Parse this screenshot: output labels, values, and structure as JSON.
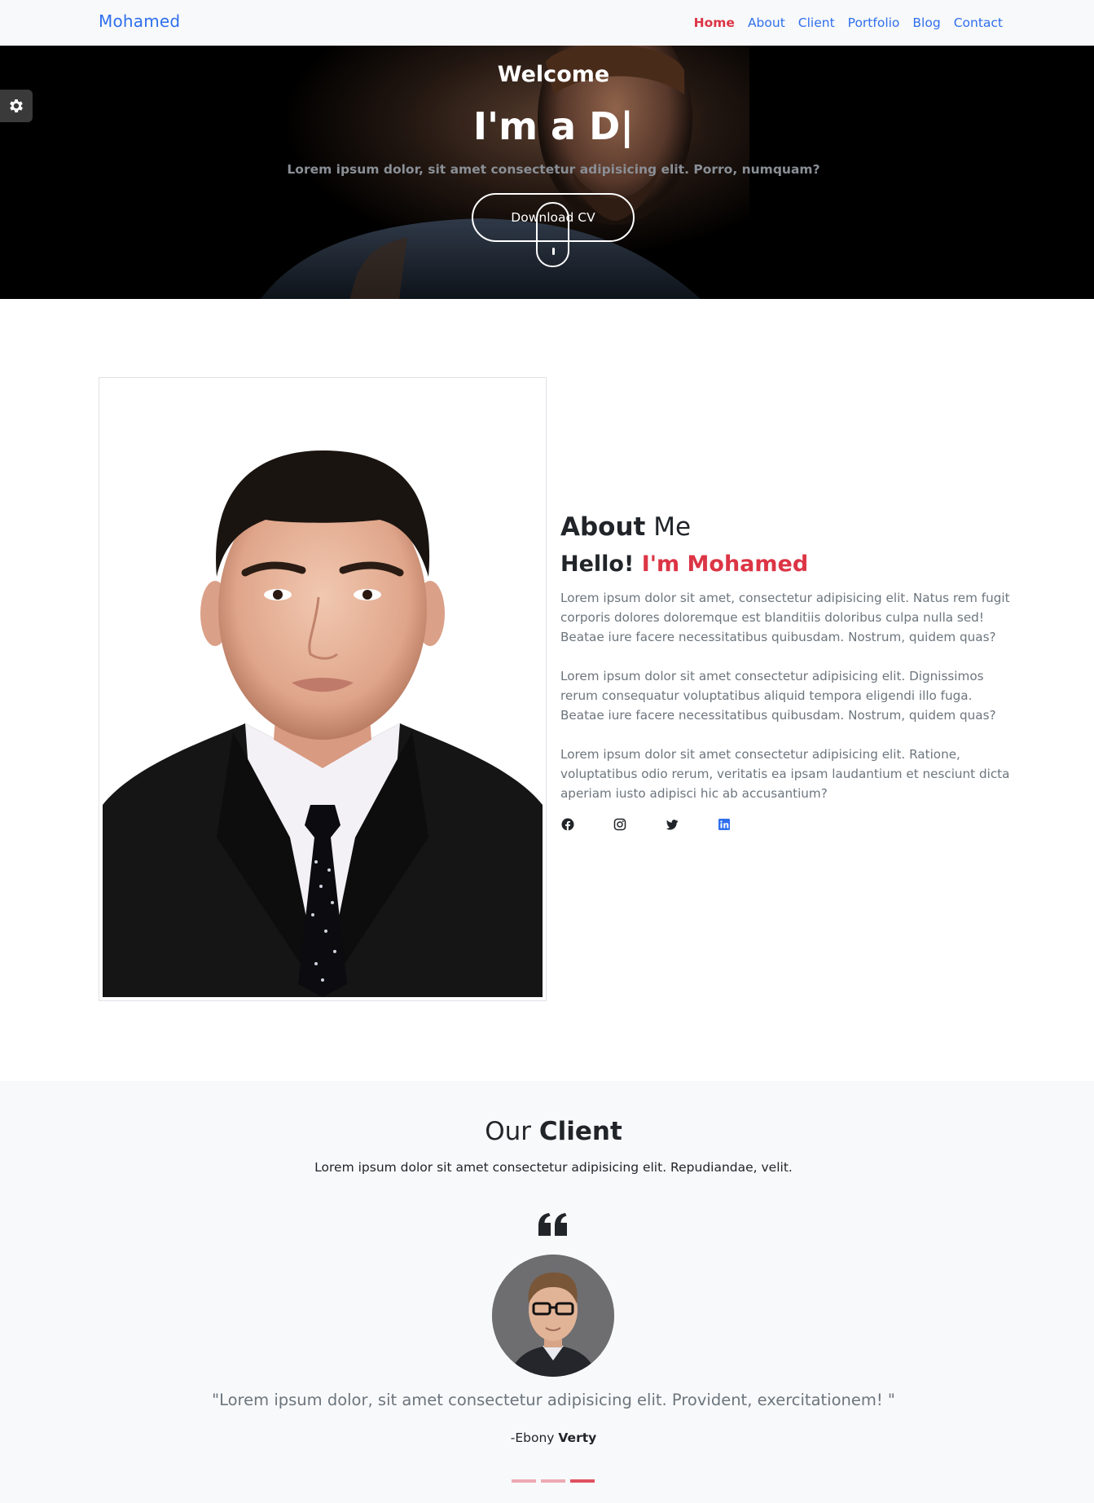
{
  "nav": {
    "brand": "Mohamed",
    "links": [
      {
        "label": "Home",
        "active": true
      },
      {
        "label": "About"
      },
      {
        "label": "Client"
      },
      {
        "label": "Portfolio"
      },
      {
        "label": "Blog"
      },
      {
        "label": "Contact"
      }
    ]
  },
  "hero": {
    "welcome": "Welcome",
    "title": "I'm a D|",
    "subtitle": "Lorem ipsum dolor, sit amet consectetur adipisicing elit. Porro, numquam?",
    "button": "Download CV"
  },
  "settings": {
    "icon": "gear-icon"
  },
  "about": {
    "heading_bold": "About",
    "heading_rest": " Me",
    "hello": "Hello! ",
    "hello_name": "I'm Mohamed",
    "paragraphs": [
      "Lorem ipsum dolor sit amet, consectetur adipisicing elit. Natus rem fugit corporis dolores doloremque est blanditiis doloribus culpa nulla sed! Beatae iure facere necessitatibus quibusdam. Nostrum, quidem quas?",
      "Lorem ipsum dolor sit amet consectetur adipisicing elit. Dignissimos rerum consequatur voluptatibus aliquid tempora eligendi illo fuga. Beatae iure facere necessitatibus quibusdam. Nostrum, quidem quas?",
      "Lorem ipsum dolor sit amet consectetur adipisicing elit. Ratione, voluptatibus odio rerum, veritatis ea ipsam laudantium et nesciunt dicta aperiam iusto adipisci hic ab accusantium?"
    ],
    "socials": [
      "facebook-icon",
      "instagram-icon",
      "twitter-icon",
      "linkedin-icon"
    ]
  },
  "client": {
    "title_light": "Our ",
    "title_bold": "Client",
    "subtitle": "Lorem ipsum dolor sit amet consectetur adipisicing elit. Repudiandae, velit.",
    "quote": "\"Lorem ipsum dolor, sit amet consectetur adipisicing elit. Provident, exercitationem! \"",
    "author_prefix": "-Ebony ",
    "author_bold": "Verty",
    "slides": 3,
    "active_slide": 3
  },
  "colors": {
    "accent": "#dc3545",
    "link": "#2f6fed",
    "muted": "#6c757d",
    "light_bg": "#f8f9fa"
  }
}
